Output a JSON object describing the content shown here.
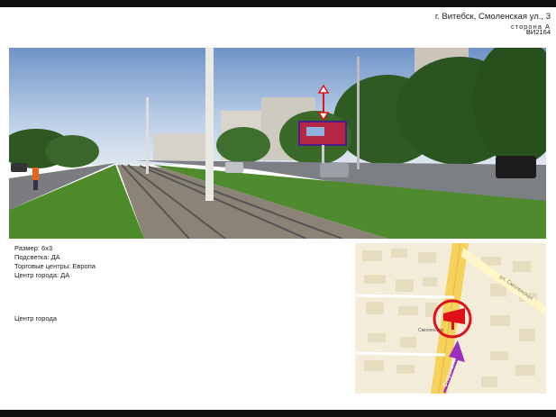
{
  "header": {
    "address": "г. Витебск, Смоленская ул., 3",
    "side": "сторона А",
    "code": "ВИ2164"
  },
  "info": {
    "size": "Размер: 6х3",
    "lighting": "Подсветка: ДА",
    "malls": "Торговые центры: Европа",
    "city_center": "Центр города: ДА"
  },
  "zone_note": "Центр города",
  "map": {
    "street_label": "ул. Смоленская",
    "side_label": "Сторона А",
    "place_label": "Смоленская",
    "accent_color": "#e0101a",
    "arrow_color": "#9b2fc0",
    "road_color": "#f6d25a"
  },
  "photo": {
    "description_icon": "billboard-photo"
  }
}
